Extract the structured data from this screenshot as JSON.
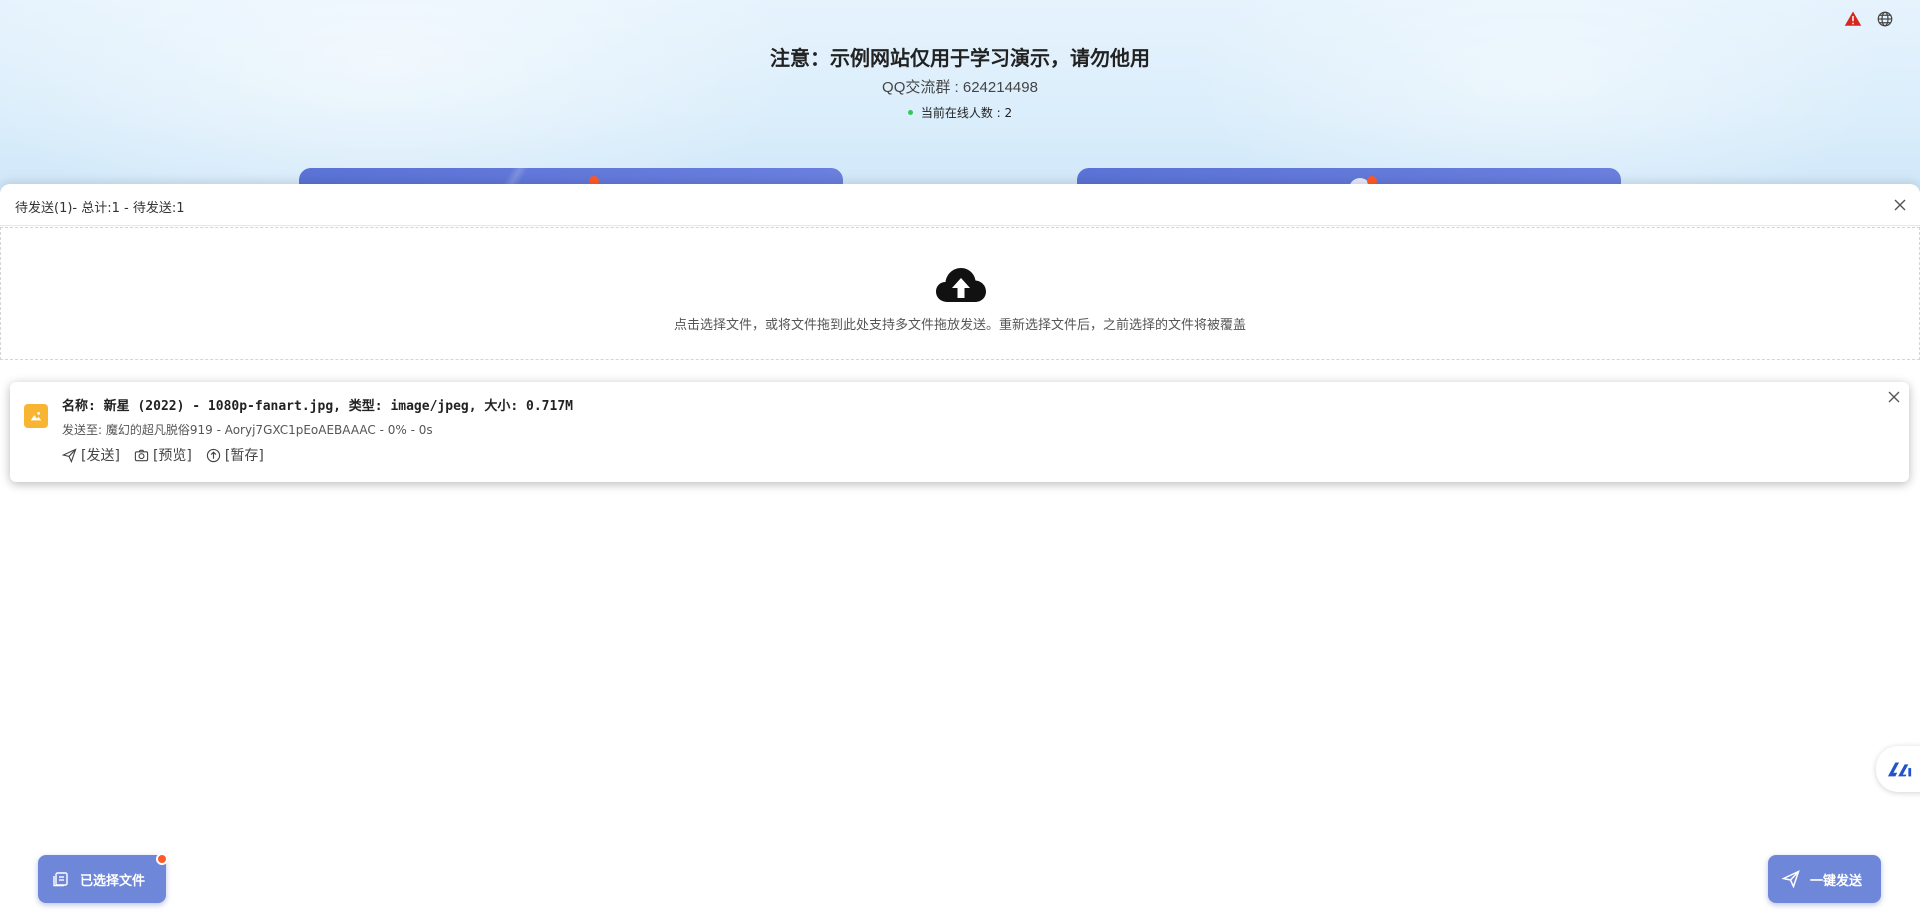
{
  "header": {
    "notice": "注意：示例网站仅用于学习演示，请勿他用",
    "qq_group": "QQ交流群 : 624214498",
    "online_count": "当前在线人数 : 2"
  },
  "panel": {
    "title": "待发送(1)- 总计:1 - 待发送:1",
    "dropzone_hint": "点击选择文件，或将文件拖到此处支持多文件拖放发送。重新选择文件后，之前选择的文件将被覆盖"
  },
  "file_item": {
    "name_line": "名称: 新星 (2022) - 1080p-fanart.jpg, 类型: image/jpeg, 大小: 0.717M",
    "target_line": "发送至: 魔幻的超凡脱俗919 - Aoryj7GXC1pEoAEBAAAC - 0% - 0s",
    "actions": {
      "send": "[发送]",
      "preview": "[预览]",
      "pause": "[暂存]"
    }
  },
  "buttons": {
    "selected_files": "已选择文件",
    "send_all": "一键发送"
  },
  "colors": {
    "accent": "#6f87d9",
    "badge": "#ff5a2a",
    "online_dot": "#34c759",
    "warning": "#d9261c",
    "file_thumb": "#f7b531"
  },
  "icons": {
    "warning": "warning-icon",
    "globe": "globe-icon",
    "close": "close-icon",
    "cloud_upload": "cloud-upload-icon",
    "image": "image-icon",
    "send": "send-icon",
    "camera": "camera-icon",
    "upload_circle": "upload-circle-icon",
    "files": "files-icon",
    "logo": "logo-icon"
  }
}
